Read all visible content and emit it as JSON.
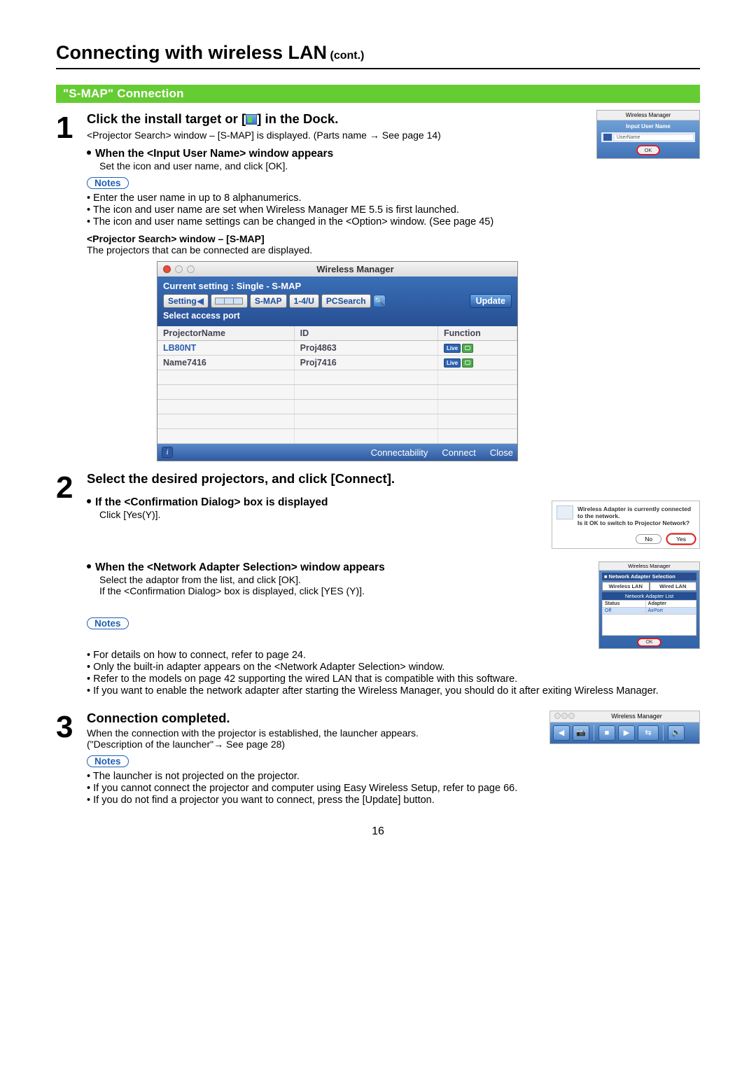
{
  "page": {
    "number": "16"
  },
  "title": {
    "main": "Connecting with wireless LAN",
    "cont": " (cont.)"
  },
  "section_band": "\"S-MAP\" Connection",
  "step1": {
    "num": "1",
    "title_before": "Click the install target or [",
    "title_after": "] in the Dock.",
    "desc": "<Projector Search> window – [S-MAP] is displayed. (Parts name → See page 14)",
    "sub1_head": "When the <Input User Name> window appears",
    "sub1_body": "Set the icon and user name, and click [OK].",
    "notes_label": "Notes",
    "notes": [
      "• Enter the user name in up to 8 alphanumerics.",
      "• The icon and user name are set when Wireless Manager ME 5.5 is first launched.",
      "• The icon and user name settings can be changed in the <Option> window. (See page 45)"
    ],
    "ps_head": "<Projector Search> window – [S-MAP]",
    "ps_body": "The projectors that can be connected are displayed."
  },
  "fig_input_user": {
    "titlebar": "Wireless Manager",
    "header": "Input User Name",
    "field_label": "UserName",
    "ok": "OK"
  },
  "proj_window": {
    "title": "Wireless Manager",
    "current_setting": "Current setting : Single - S-MAP",
    "btn_setting": "Setting",
    "tab_smap": "S-MAP",
    "tab_14u": "1-4/U",
    "tab_pcsearch": "PCSearch",
    "btn_update": "Update",
    "select_access": "Select access port",
    "cols": {
      "name": "ProjectorName",
      "id": "ID",
      "func": "Function"
    },
    "rows": [
      {
        "name": "LB80NT",
        "id": "Proj4863"
      },
      {
        "name": "Name7416",
        "id": "Proj7416"
      }
    ],
    "btn_connectability": "Connectability",
    "btn_connect": "Connect",
    "btn_close": "Close"
  },
  "step2": {
    "num": "2",
    "title": "Select the desired projectors, and click [Connect].",
    "sub1_head": "If the <Confirmation Dialog> box is displayed",
    "sub1_body": "Click [Yes(Y)].",
    "sub2_head": "When the <Network Adapter Selection> window appears",
    "sub2_body1": "Select the adaptor from the list, and click [OK].",
    "sub2_body2": "If the <Confirmation Dialog> box is displayed, click [YES (Y)].",
    "notes_label": "Notes",
    "notes": [
      "• For details on how to connect, refer to page 24.",
      "• Only the built-in adapter appears on the <Network Adapter Selection> window.",
      "• Refer to the models on page 42 supporting the wired LAN that is compatible with this software.",
      "• If you want to enable the network adapter after starting the Wireless Manager, you should do it after exiting Wireless Manager."
    ]
  },
  "fig_conf": {
    "line1": "Wireless Adapter is currently connected to the network.",
    "line2": "Is it OK to switch to Projector Network?",
    "no": "No",
    "yes": "Yes"
  },
  "fig_nas": {
    "titlebar": "Wireless Manager",
    "header": "Network Adapter Selection",
    "tab_wireless": "Wireless LAN",
    "tab_wired": "Wired LAN",
    "list_header": "Network Adapter List",
    "col_status": "Status",
    "col_adapter": "Adapter",
    "row_status": "Off",
    "row_adapter": "AirPort",
    "ok": "OK"
  },
  "step3": {
    "num": "3",
    "title": "Connection completed.",
    "body": "When the connection with the projector is established, the launcher appears. (\"Description of the launcher\"→ See page 28)",
    "notes_label": "Notes",
    "notes": [
      "• The launcher is not projected on the projector.",
      "• If you cannot connect the projector and computer using Easy Wireless Setup, refer to page 66.",
      "• If you do not find a projector you want to connect, press the [Update] button."
    ]
  },
  "fig_launcher": {
    "title": "Wireless Manager"
  }
}
